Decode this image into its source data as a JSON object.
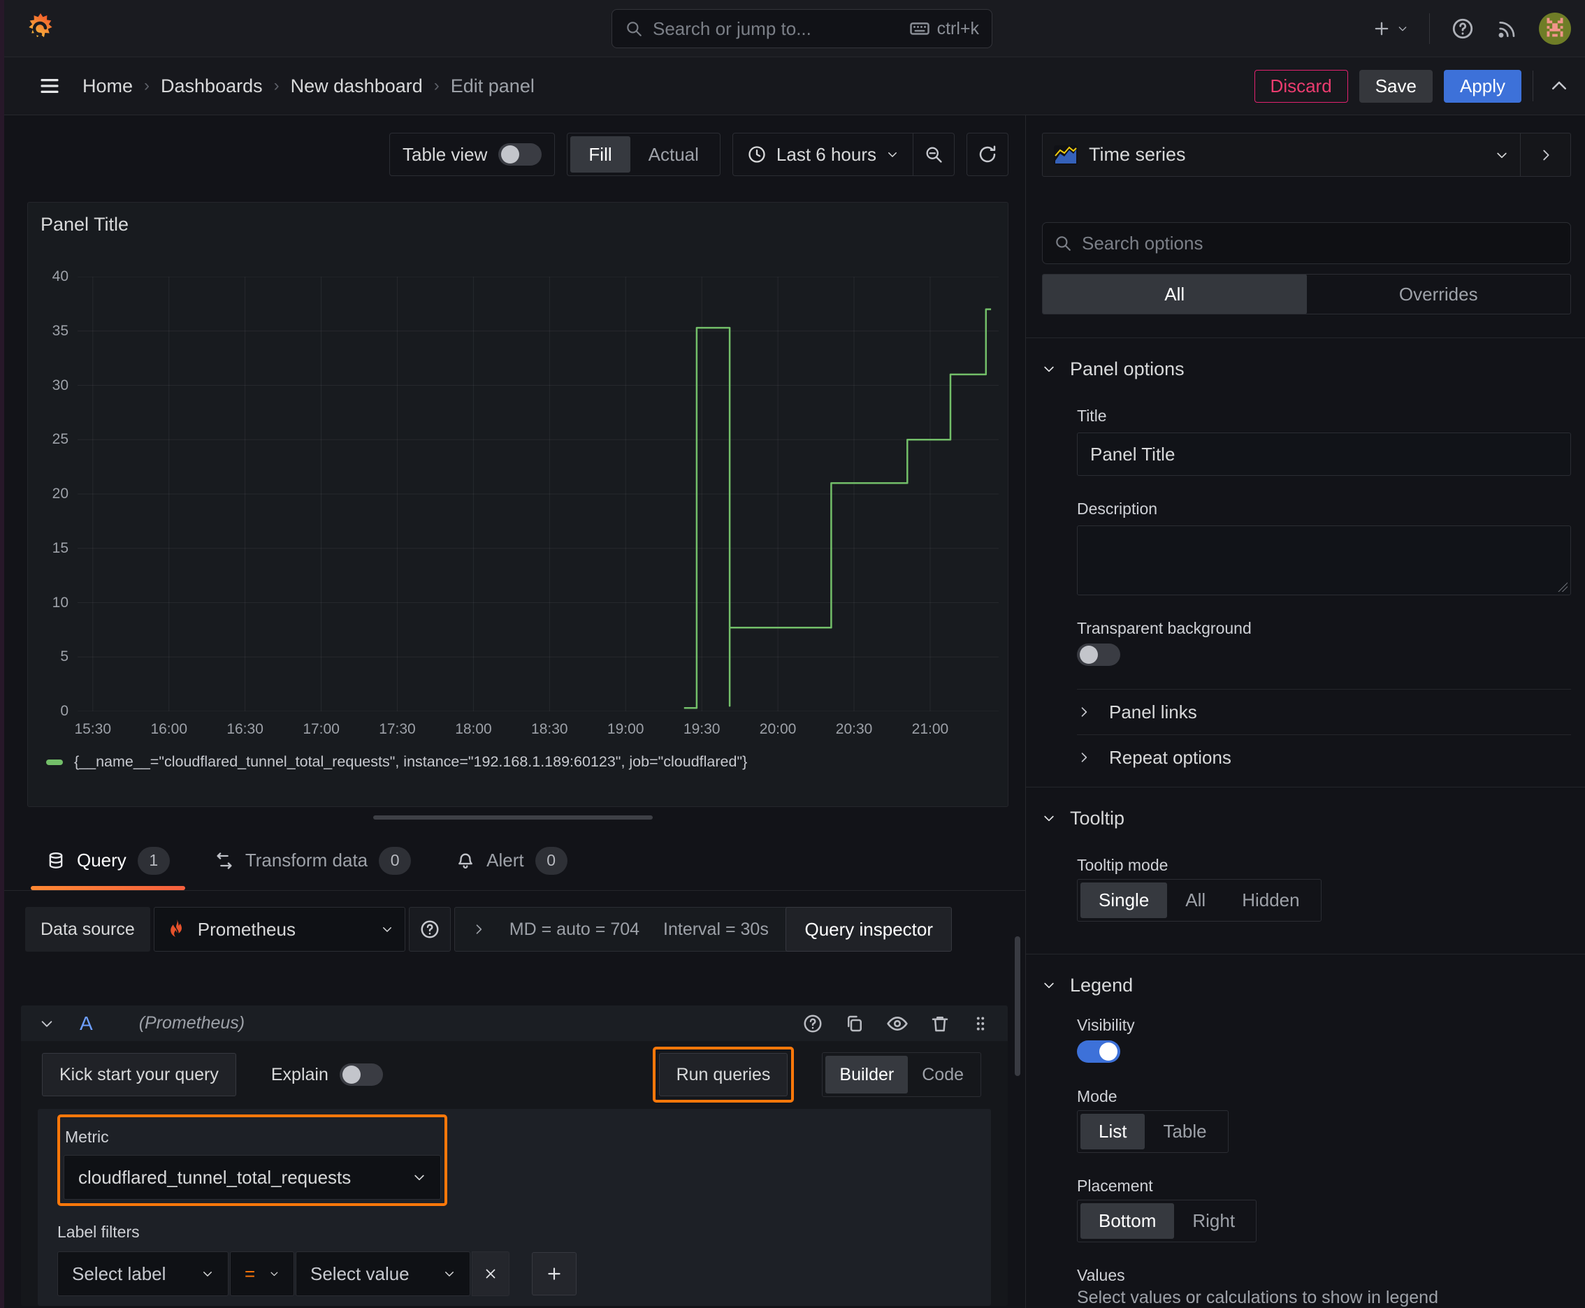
{
  "nav": {
    "search_placeholder": "Search or jump to...",
    "shortcut": "ctrl+k"
  },
  "breadcrumb": {
    "items": [
      "Home",
      "Dashboards",
      "New dashboard",
      "Edit panel"
    ]
  },
  "actions": {
    "discard": "Discard",
    "save": "Save",
    "apply": "Apply"
  },
  "toolbar": {
    "table_view": "Table view",
    "fill": "Fill",
    "actual": "Actual",
    "time_range": "Last 6 hours"
  },
  "viz_picker": {
    "label": "Time series"
  },
  "panel": {
    "title": "Panel Title"
  },
  "chart_data": {
    "type": "line",
    "line_style": "step",
    "title": "",
    "xlabel": "",
    "ylabel": "",
    "ylim": [
      0,
      40
    ],
    "y_ticks": [
      0,
      5,
      10,
      15,
      20,
      25,
      30,
      35,
      40
    ],
    "x_domain": [
      "15:24",
      "21:27"
    ],
    "x_ticks": [
      "15:30",
      "16:00",
      "16:30",
      "17:00",
      "17:30",
      "18:00",
      "18:30",
      "19:00",
      "19:30",
      "20:00",
      "20:30",
      "21:00"
    ],
    "grid": true,
    "legend_position": "bottom",
    "series": [
      {
        "name": "{__name__=\"cloudflared_tunnel_total_requests\", instance=\"192.168.1.189:60123\", job=\"cloudflared\"}",
        "color": "#73bf69",
        "points": [
          [
            "19:23",
            0.3
          ],
          [
            "19:28",
            0.3
          ],
          [
            "19:28",
            35.3
          ],
          [
            "19:41",
            35.3
          ],
          [
            "19:41",
            0.5
          ],
          [
            "19:41",
            7.7
          ],
          [
            "20:21",
            7.7
          ],
          [
            "20:21",
            21
          ],
          [
            "20:51",
            21
          ],
          [
            "20:51",
            25
          ],
          [
            "21:08",
            25
          ],
          [
            "21:08",
            31
          ],
          [
            "21:22",
            31
          ],
          [
            "21:22",
            37
          ],
          [
            "21:24",
            37
          ]
        ]
      }
    ]
  },
  "tabs": [
    {
      "label": "Query",
      "badge": "1"
    },
    {
      "label": "Transform data",
      "badge": "0"
    },
    {
      "label": "Alert",
      "badge": "0"
    }
  ],
  "query": {
    "datasource_label": "Data source",
    "datasource": "Prometheus",
    "stats_md": "MD = auto = 704",
    "stats_interval": "Interval = 30s",
    "inspector": "Query inspector",
    "ref_id": "A",
    "ref_ds": "(Prometheus)",
    "kick_start": "Kick start your query",
    "explain": "Explain",
    "run": "Run queries",
    "builder": "Builder",
    "code": "Code",
    "metric_label": "Metric",
    "metric_value": "cloudflared_tunnel_total_requests",
    "label_filters": "Label filters",
    "select_label": "Select label",
    "op": "=",
    "select_value": "Select value"
  },
  "options": {
    "search_placeholder": "Search options",
    "tab_all": "All",
    "tab_overrides": "Overrides",
    "panel_options": "Panel options",
    "title_label": "Title",
    "title_value": "Panel Title",
    "description_label": "Description",
    "transparent": "Transparent background",
    "panel_links": "Panel links",
    "repeat_options": "Repeat options",
    "tooltip": "Tooltip",
    "tooltip_mode": "Tooltip mode",
    "tt_single": "Single",
    "tt_all": "All",
    "tt_hidden": "Hidden",
    "legend": "Legend",
    "visibility": "Visibility",
    "mode": "Mode",
    "mode_list": "List",
    "mode_table": "Table",
    "placement": "Placement",
    "pl_bottom": "Bottom",
    "pl_right": "Right",
    "values": "Values",
    "values_help": "Select values or calculations to show in legend"
  },
  "colors": {
    "accent_orange": "#ff780a",
    "series_green": "#73bf69",
    "apply_blue": "#3d71d9",
    "discard_pink": "#e0226e",
    "prometheus_orange": "#e6522c"
  }
}
